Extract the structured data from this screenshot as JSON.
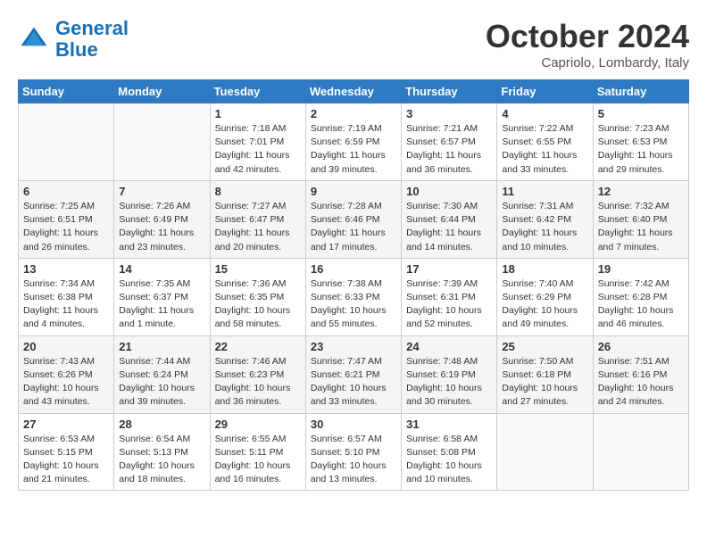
{
  "header": {
    "logo_line1": "General",
    "logo_line2": "Blue",
    "title": "October 2024",
    "subtitle": "Capriolo, Lombardy, Italy"
  },
  "days_of_week": [
    "Sunday",
    "Monday",
    "Tuesday",
    "Wednesday",
    "Thursday",
    "Friday",
    "Saturday"
  ],
  "weeks": [
    [
      {
        "day": "",
        "info": ""
      },
      {
        "day": "",
        "info": ""
      },
      {
        "day": "1",
        "info": "Sunrise: 7:18 AM\nSunset: 7:01 PM\nDaylight: 11 hours and 42 minutes."
      },
      {
        "day": "2",
        "info": "Sunrise: 7:19 AM\nSunset: 6:59 PM\nDaylight: 11 hours and 39 minutes."
      },
      {
        "day": "3",
        "info": "Sunrise: 7:21 AM\nSunset: 6:57 PM\nDaylight: 11 hours and 36 minutes."
      },
      {
        "day": "4",
        "info": "Sunrise: 7:22 AM\nSunset: 6:55 PM\nDaylight: 11 hours and 33 minutes."
      },
      {
        "day": "5",
        "info": "Sunrise: 7:23 AM\nSunset: 6:53 PM\nDaylight: 11 hours and 29 minutes."
      }
    ],
    [
      {
        "day": "6",
        "info": "Sunrise: 7:25 AM\nSunset: 6:51 PM\nDaylight: 11 hours and 26 minutes."
      },
      {
        "day": "7",
        "info": "Sunrise: 7:26 AM\nSunset: 6:49 PM\nDaylight: 11 hours and 23 minutes."
      },
      {
        "day": "8",
        "info": "Sunrise: 7:27 AM\nSunset: 6:47 PM\nDaylight: 11 hours and 20 minutes."
      },
      {
        "day": "9",
        "info": "Sunrise: 7:28 AM\nSunset: 6:46 PM\nDaylight: 11 hours and 17 minutes."
      },
      {
        "day": "10",
        "info": "Sunrise: 7:30 AM\nSunset: 6:44 PM\nDaylight: 11 hours and 14 minutes."
      },
      {
        "day": "11",
        "info": "Sunrise: 7:31 AM\nSunset: 6:42 PM\nDaylight: 11 hours and 10 minutes."
      },
      {
        "day": "12",
        "info": "Sunrise: 7:32 AM\nSunset: 6:40 PM\nDaylight: 11 hours and 7 minutes."
      }
    ],
    [
      {
        "day": "13",
        "info": "Sunrise: 7:34 AM\nSunset: 6:38 PM\nDaylight: 11 hours and 4 minutes."
      },
      {
        "day": "14",
        "info": "Sunrise: 7:35 AM\nSunset: 6:37 PM\nDaylight: 11 hours and 1 minute."
      },
      {
        "day": "15",
        "info": "Sunrise: 7:36 AM\nSunset: 6:35 PM\nDaylight: 10 hours and 58 minutes."
      },
      {
        "day": "16",
        "info": "Sunrise: 7:38 AM\nSunset: 6:33 PM\nDaylight: 10 hours and 55 minutes."
      },
      {
        "day": "17",
        "info": "Sunrise: 7:39 AM\nSunset: 6:31 PM\nDaylight: 10 hours and 52 minutes."
      },
      {
        "day": "18",
        "info": "Sunrise: 7:40 AM\nSunset: 6:29 PM\nDaylight: 10 hours and 49 minutes."
      },
      {
        "day": "19",
        "info": "Sunrise: 7:42 AM\nSunset: 6:28 PM\nDaylight: 10 hours and 46 minutes."
      }
    ],
    [
      {
        "day": "20",
        "info": "Sunrise: 7:43 AM\nSunset: 6:26 PM\nDaylight: 10 hours and 43 minutes."
      },
      {
        "day": "21",
        "info": "Sunrise: 7:44 AM\nSunset: 6:24 PM\nDaylight: 10 hours and 39 minutes."
      },
      {
        "day": "22",
        "info": "Sunrise: 7:46 AM\nSunset: 6:23 PM\nDaylight: 10 hours and 36 minutes."
      },
      {
        "day": "23",
        "info": "Sunrise: 7:47 AM\nSunset: 6:21 PM\nDaylight: 10 hours and 33 minutes."
      },
      {
        "day": "24",
        "info": "Sunrise: 7:48 AM\nSunset: 6:19 PM\nDaylight: 10 hours and 30 minutes."
      },
      {
        "day": "25",
        "info": "Sunrise: 7:50 AM\nSunset: 6:18 PM\nDaylight: 10 hours and 27 minutes."
      },
      {
        "day": "26",
        "info": "Sunrise: 7:51 AM\nSunset: 6:16 PM\nDaylight: 10 hours and 24 minutes."
      }
    ],
    [
      {
        "day": "27",
        "info": "Sunrise: 6:53 AM\nSunset: 5:15 PM\nDaylight: 10 hours and 21 minutes."
      },
      {
        "day": "28",
        "info": "Sunrise: 6:54 AM\nSunset: 5:13 PM\nDaylight: 10 hours and 18 minutes."
      },
      {
        "day": "29",
        "info": "Sunrise: 6:55 AM\nSunset: 5:11 PM\nDaylight: 10 hours and 16 minutes."
      },
      {
        "day": "30",
        "info": "Sunrise: 6:57 AM\nSunset: 5:10 PM\nDaylight: 10 hours and 13 minutes."
      },
      {
        "day": "31",
        "info": "Sunrise: 6:58 AM\nSunset: 5:08 PM\nDaylight: 10 hours and 10 minutes."
      },
      {
        "day": "",
        "info": ""
      },
      {
        "day": "",
        "info": ""
      }
    ]
  ]
}
